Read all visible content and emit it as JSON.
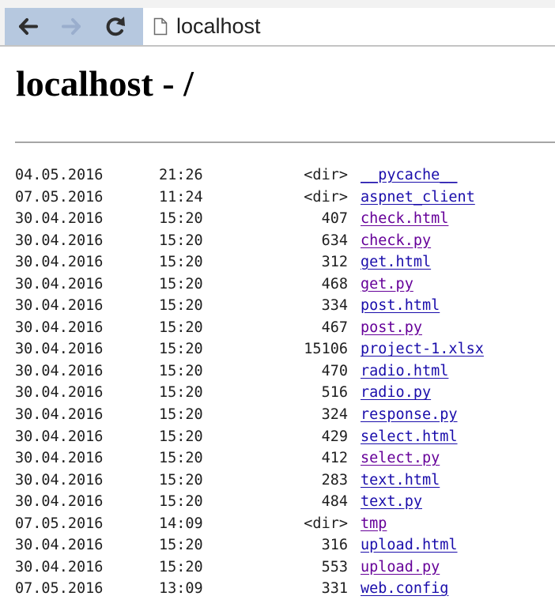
{
  "browser": {
    "back_icon": "arrow-left-icon",
    "forward_icon": "arrow-right-icon",
    "reload_icon": "reload-icon",
    "page_icon": "page-icon",
    "address": "localhost"
  },
  "page": {
    "title": "localhost - /"
  },
  "colors": {
    "link": "#1a0dab",
    "visited": "#660099"
  },
  "listing": [
    {
      "date": "04.05.2016",
      "time": "21:26",
      "size": "<dir>",
      "name": "__pycache__",
      "visited": false
    },
    {
      "date": "07.05.2016",
      "time": "11:24",
      "size": "<dir>",
      "name": "aspnet_client",
      "visited": false
    },
    {
      "date": "30.04.2016",
      "time": "15:20",
      "size": "407",
      "name": "check.html",
      "visited": true
    },
    {
      "date": "30.04.2016",
      "time": "15:20",
      "size": "634",
      "name": "check.py",
      "visited": true
    },
    {
      "date": "30.04.2016",
      "time": "15:20",
      "size": "312",
      "name": "get.html",
      "visited": false
    },
    {
      "date": "30.04.2016",
      "time": "15:20",
      "size": "468",
      "name": "get.py",
      "visited": true
    },
    {
      "date": "30.04.2016",
      "time": "15:20",
      "size": "334",
      "name": "post.html",
      "visited": false
    },
    {
      "date": "30.04.2016",
      "time": "15:20",
      "size": "467",
      "name": "post.py",
      "visited": true
    },
    {
      "date": "30.04.2016",
      "time": "15:20",
      "size": "15106",
      "name": "project-1.xlsx",
      "visited": false
    },
    {
      "date": "30.04.2016",
      "time": "15:20",
      "size": "470",
      "name": "radio.html",
      "visited": false
    },
    {
      "date": "30.04.2016",
      "time": "15:20",
      "size": "516",
      "name": "radio.py",
      "visited": false
    },
    {
      "date": "30.04.2016",
      "time": "15:20",
      "size": "324",
      "name": "response.py",
      "visited": false
    },
    {
      "date": "30.04.2016",
      "time": "15:20",
      "size": "429",
      "name": "select.html",
      "visited": false
    },
    {
      "date": "30.04.2016",
      "time": "15:20",
      "size": "412",
      "name": "select.py",
      "visited": true
    },
    {
      "date": "30.04.2016",
      "time": "15:20",
      "size": "283",
      "name": "text.html",
      "visited": false
    },
    {
      "date": "30.04.2016",
      "time": "15:20",
      "size": "484",
      "name": "text.py",
      "visited": false
    },
    {
      "date": "07.05.2016",
      "time": "14:09",
      "size": "<dir>",
      "name": "tmp",
      "visited": true
    },
    {
      "date": "30.04.2016",
      "time": "15:20",
      "size": "316",
      "name": "upload.html",
      "visited": false
    },
    {
      "date": "30.04.2016",
      "time": "15:20",
      "size": "553",
      "name": "upload.py",
      "visited": true
    },
    {
      "date": "07.05.2016",
      "time": "13:09",
      "size": "331",
      "name": "web.config",
      "visited": false
    }
  ]
}
